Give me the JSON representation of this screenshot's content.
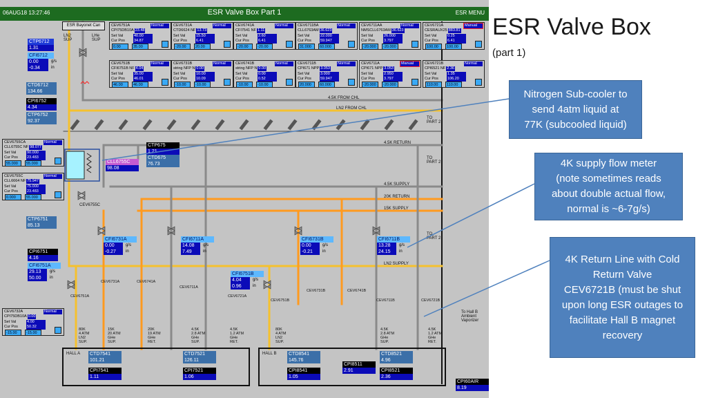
{
  "hmi": {
    "timestamp": "06AUG18 13:27:46",
    "title": "ESR Valve Box Part 1",
    "menu": "ESR MENU",
    "bayonet": "ESR Bayonet Can",
    "ln2_sup": "LN2\nSUP",
    "lhe_sup": "LHe\nSUP",
    "left_readouts": {
      "ctp6712": {
        "tag": "CTP6712",
        "val": "1.31"
      },
      "cfi6712": {
        "tag": "CFI6712",
        "flow": "0.00",
        "flow_unit": "g/s",
        "in": "-0.34",
        "in_unit": "in"
      },
      "ctd6712": {
        "tag": "CTD6712",
        "val": "134.66"
      },
      "cpi6752": {
        "tag": "CPI6752",
        "val": "4.34"
      },
      "ctp6752": {
        "tag": "CTP6752",
        "val": "92.37"
      },
      "ctp6751": {
        "tag": "CTP6751",
        "val": "85.13"
      },
      "cpi6751": {
        "tag": "CPI6751",
        "val": "4.16"
      },
      "cfi6751a": {
        "tag": "CFI6751A",
        "flow": "29.13",
        "flow_unit": "g/s",
        "in": "50.00",
        "in_unit": "in"
      }
    },
    "valve_panels": [
      {
        "name": "CEV6751A",
        "sub": "CPI75DB10A",
        "mode": "Normal",
        "sub_val": "23.48",
        "set": "40.00",
        "cur": "34.87",
        "lo": "0.00",
        "hi": "35.00"
      },
      {
        "name": "CEV6731A",
        "sub": "CTD6624 NF",
        "mode": "Normal",
        "sub_val": "13.73",
        "set": "15.50",
        "cur": "6.41",
        "lo": "-20.00",
        "hi": "20.00"
      },
      {
        "name": "CEV6741A",
        "sub": "CFI7541 NF",
        "mode": "Normal",
        "sub_val": "1.11",
        "set": "2.60",
        "cur": "6.41",
        "lo": "-20.00",
        "hi": "-20.00"
      },
      {
        "name": "CEV6711BA",
        "sub": "CLL6763AM",
        "mode": "Normal",
        "sub_val": "36.623",
        "set": "22.000",
        "cur": "59.947",
        "lo": "31.000",
        "hi": "60.000"
      },
      {
        "name": "CEV6711AA",
        "sub": "NMSCLL6763AM",
        "mode": "Normal",
        "sub_val": "36.623",
        "set": "26.000",
        "cur": "3.797",
        "lo": "-20.000",
        "hi": "-20.000"
      },
      {
        "name": "CEV6721A",
        "sub": "CESRAUX25",
        "mode": "Manual",
        "sub_val": "883.81",
        "set": "0.25",
        "cur": "6.41",
        "lo": "100.00",
        "hi": "100.00"
      },
      {
        "name": "CEV6751B",
        "sub": "CFI6751B NF",
        "mode": "Normal",
        "sub_val": "4.04",
        "set": "35.00",
        "cur": "46.01",
        "lo": "46.00",
        "hi": "46.00"
      },
      {
        "name": "CEV6731B",
        "sub": "string NFP N",
        "mode": "Normal",
        "sub_val": "0.00",
        "set": "10.00",
        "cur": "10.09",
        "lo": "-10.00",
        "hi": "-10.00"
      },
      {
        "name": "CEV6741B",
        "sub": "string NFP N",
        "mode": "Normal",
        "sub_val": "0.00",
        "set": "0.00",
        "cur": "0.52",
        "lo": "-10.00",
        "hi": "-10.00"
      },
      {
        "name": "CEV6711B",
        "sub": "CPI671 NPP",
        "mode": "Normal",
        "sub_val": "3.053",
        "set": "3.000",
        "cur": "59.947",
        "lo": "20.000",
        "hi": "60.000"
      },
      {
        "name": "CEV6711A",
        "sub": "CPI671 NPP",
        "mode": "Manual",
        "sub_val": "3.053",
        "set": "2.950",
        "cur": "3.797",
        "lo": "-20.000",
        "hi": "-20.000"
      },
      {
        "name": "CEV6721B",
        "sub": "CPI6521 NF",
        "mode": "Normal",
        "sub_val": "2.36",
        "set": "1.35",
        "cur": "106.20",
        "lo": "110.00",
        "hi": "110.00"
      }
    ],
    "left_panels": [
      {
        "name": "CEV6755CA",
        "sub": "CLL6755C NF",
        "mode": "Normal",
        "sub_val": "98.077",
        "set": "90.000",
        "cur": "23.483",
        "lo": "55.000",
        "hi": "55.000"
      },
      {
        "name": "CEV6755C",
        "sub": "CLL6664 NF",
        "mode": "Normal",
        "sub_val": "75.947",
        "set": "75.000",
        "cur": "23.483",
        "lo": "0.000",
        "hi": "55.000"
      },
      {
        "name": "CEV6732A",
        "sub": "CPI75DB10A",
        "mode": "Normal",
        "sub_val": "0.00",
        "set": "4.00",
        "cur": "50.32",
        "lo": "-15.00",
        "hi": "-15.00"
      }
    ],
    "panel_labels": {
      "set": "Set Val",
      "cur": "Cur Pos"
    },
    "header_lines": {
      "k45_from_chl": "4.5K FROM CHL",
      "ln2_from_chl": "LN2 FROM CHL",
      "k45_return": "4.5K RETURN",
      "k45_supply": "4.5K SUPPLY",
      "k20_return": "20K RETURN",
      "k15_supply": "15K SUPPLY",
      "ln2_supply": "LN2 SUPPLY",
      "to_part2": "TO\nPART 2",
      "to_hall_b": "To Hall B\nAmbient\nVaporizer"
    },
    "center_tags": {
      "ctp675": {
        "tag": "CTP675",
        "val": "1.21"
      },
      "ctd675": {
        "tag": "CTD675",
        "val": "76.73"
      },
      "cll6755c": {
        "tag": "CLL6755C",
        "val": "98.08"
      },
      "cev6755c": "CEV6755C"
    },
    "flow_meters": [
      {
        "tag": "CFI6731A",
        "flow": "0.00",
        "in": "-0.27"
      },
      {
        "tag": "CFI6711A",
        "flow": "14.08",
        "in": "7.49"
      },
      {
        "tag": "CFI6731B",
        "flow": "0.00",
        "in": "-0.21"
      },
      {
        "tag": "CFI6711B",
        "flow": "13.28",
        "in": "24.15"
      },
      {
        "tag": "CFI6751B",
        "flow": "4.04",
        "in": "0.96"
      }
    ],
    "flow_units": {
      "flow": "g/s",
      "in": "in"
    },
    "valve_labels": [
      "CEV6731A",
      "CEV6741A",
      "CEV6711A",
      "CEV6751A",
      "CEV6721A",
      "CEV6751B",
      "CEV6731B",
      "CEV6741B",
      "CEV6711B",
      "CEV6721B",
      "CEV6755C"
    ],
    "pipe_labels": [
      "80K\n4 ATM\nLN2\nSUP.",
      "15K\n20 ATM\nGHe\nSUP.",
      "20K\n19 ATM\nGHe\nRET.",
      "4.5K\n2.8 ATM\nGHe\nSUP.",
      "4.5K\n1.2 ATM\nGHe\nRET.",
      "80K\n4 ATM\nLN2\nSUP.",
      "4.5K\n2.8 ATM\nGHe\nSUP.",
      "4.5K\n1.2 ATM\nGHe\nRET."
    ],
    "hall_a": {
      "name": "HALL A",
      "ctd7541": {
        "tag": "CTD7541",
        "val": "101.21"
      },
      "cpi7541": {
        "tag": "CPI7541",
        "val": "1.11"
      },
      "ctd7521": {
        "tag": "CTD7521",
        "val": "126.11"
      },
      "cpi7521": {
        "tag": "CPI7521",
        "val": "1.06"
      }
    },
    "hall_b": {
      "name": "HALL B",
      "ctd8541": {
        "tag": "CTD8541",
        "val": "145.76"
      },
      "cpi8541": {
        "tag": "CPI8541",
        "val": "1.05"
      },
      "cpi8511": {
        "tag": "CPI8511",
        "val": "2.91"
      },
      "ctd8521": {
        "tag": "CTD8521",
        "val": "4.96"
      },
      "cpi8521": {
        "tag": "CPI8521",
        "val": "2.36"
      }
    },
    "cpi60air": {
      "tag": "CPI60AIR",
      "val": "8.19"
    }
  },
  "slide": {
    "title": "ESR Valve Box",
    "subtitle": "(part 1)",
    "callouts": [
      {
        "lines": [
          "Nitrogen Sub-cooler to",
          "send 4atm liquid at",
          "77K (subcooled liquid)"
        ]
      },
      {
        "lines": [
          "4K supply flow meter",
          "(note sometimes reads",
          "about double actual flow,",
          "normal is ~6-7g/s)"
        ]
      },
      {
        "lines": [
          "4K Return Line with Cold",
          "Return Valve",
          "CEV6721B (must be shut",
          "upon long ESR outages to",
          "facilitate Hall B magnet",
          "recovery"
        ]
      }
    ]
  },
  "colors": {
    "hmi_bg": "#c4c4c4",
    "title_bar": "#1d6b20",
    "ln2_pipe": "#f5c12e",
    "ghe_pipe": "#ff9a1f",
    "return_pipe": "#8a8a8a",
    "callout_fill": "#4f81bd"
  }
}
